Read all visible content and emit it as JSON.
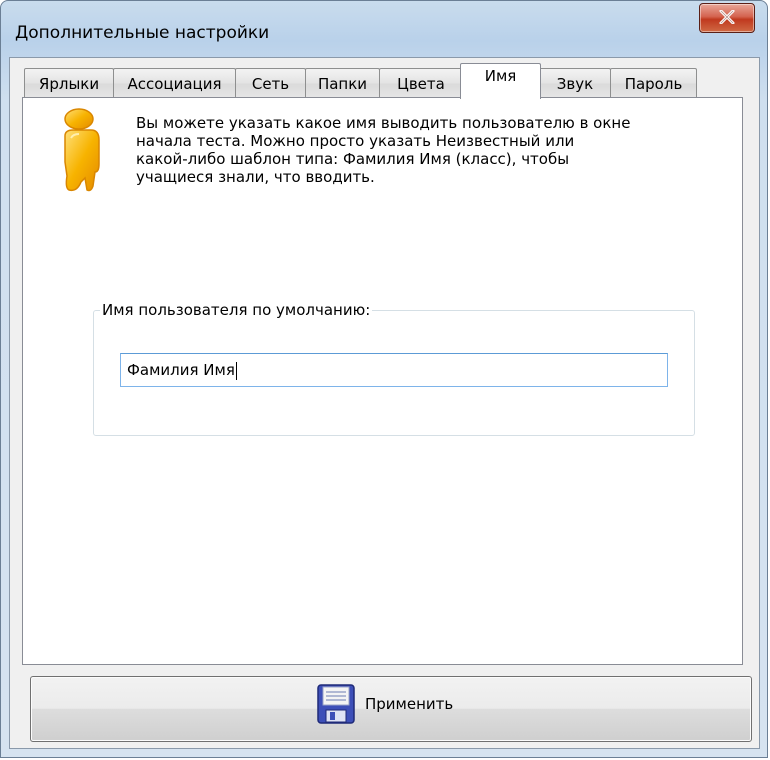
{
  "window": {
    "title": "Дополнительные настройки"
  },
  "tabs": [
    {
      "label": "Ярлыки"
    },
    {
      "label": "Ассоциация"
    },
    {
      "label": "Сеть"
    },
    {
      "label": "Папки"
    },
    {
      "label": "Цвета"
    },
    {
      "label": "Имя",
      "active": true
    },
    {
      "label": "Звук"
    },
    {
      "label": "Пароль"
    }
  ],
  "panel": {
    "icon": "user-icon",
    "description_lines": [
      "Вы можете указать какое имя выводить пользователю в окне",
      "начала теста. Можно просто указать Неизвестный или",
      "какой-либо шаблон типа: Фамилия Имя (класс), чтобы",
      "учащиеся знали, что вводить."
    ],
    "group_label": "Имя пользователя по умолчанию:",
    "default_name_value": "Фамилия Имя"
  },
  "apply": {
    "label": "Применить",
    "icon": "floppy-disk-icon"
  },
  "colors": {
    "accent_focus": "#7eb4ea",
    "close_red": "#c0391f",
    "user_icon_orange": "#f5a800"
  }
}
